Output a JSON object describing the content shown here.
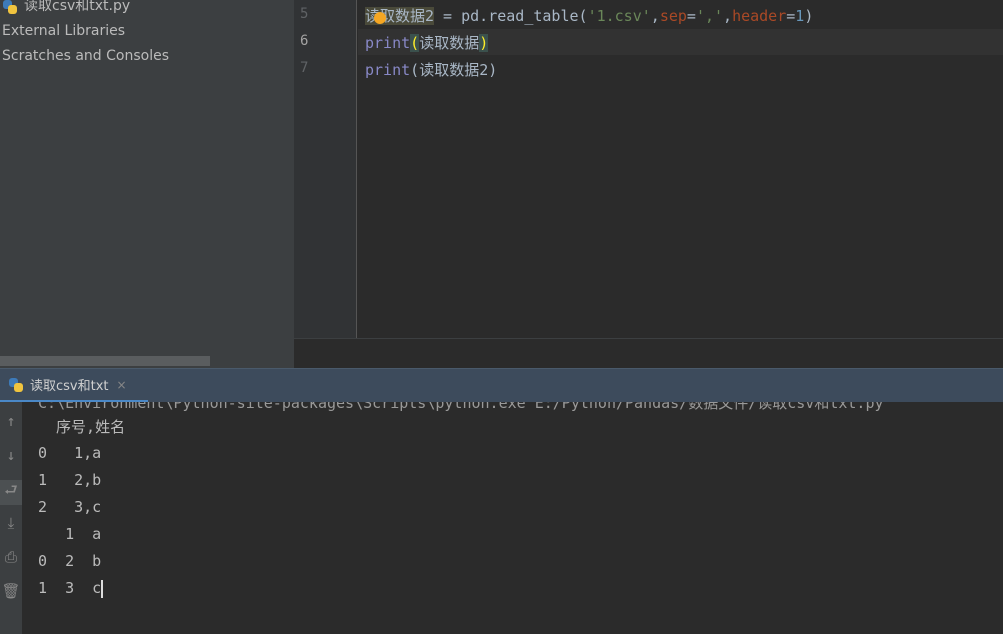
{
  "sidebar": {
    "items": [
      {
        "label": "读取csv和txt.py",
        "icon": "python-file-icon"
      },
      {
        "label": "External Libraries"
      },
      {
        "label": "Scratches and Consoles"
      }
    ]
  },
  "editor": {
    "lines": [
      {
        "num": "5",
        "var": "读取数据2",
        "rest_a": " = pd.read_table(",
        "str1": "'1.csv'",
        "comma1": ",",
        "p1": "sep",
        "eq1": "=",
        "str2": "','",
        "comma2": ",",
        "p2": "header",
        "eq2": "=",
        "n": "1",
        "close": ")"
      },
      {
        "num": "6",
        "fn": "print",
        "open": "(",
        "arg": "读取数据",
        "close": ")"
      },
      {
        "num": "7",
        "fn": "print",
        "open": "(",
        "arg": "读取数据2",
        "close": ")"
      }
    ]
  },
  "run": {
    "tab_label": "读取csv和txt",
    "close": "×",
    "output": [
      "C:\\Environment\\Python-site-packages\\Scripts\\python.exe E:/Python/Pandas/数据文件/读取csv和txt.py",
      "  序号,姓名",
      "0   1,a",
      "1   2,b",
      "2   3,c",
      "   1  a",
      "0  2  b",
      "1  3  c"
    ]
  },
  "tools": [
    "arrow-up-icon",
    "arrow-down-icon",
    "soft-wrap-icon",
    "scroll-to-end-icon",
    "print-icon",
    "trash-icon"
  ],
  "colors": {
    "accent": "#4a88c7",
    "keyword": "#8888c6",
    "string": "#6a8759",
    "param": "#aa4926"
  }
}
